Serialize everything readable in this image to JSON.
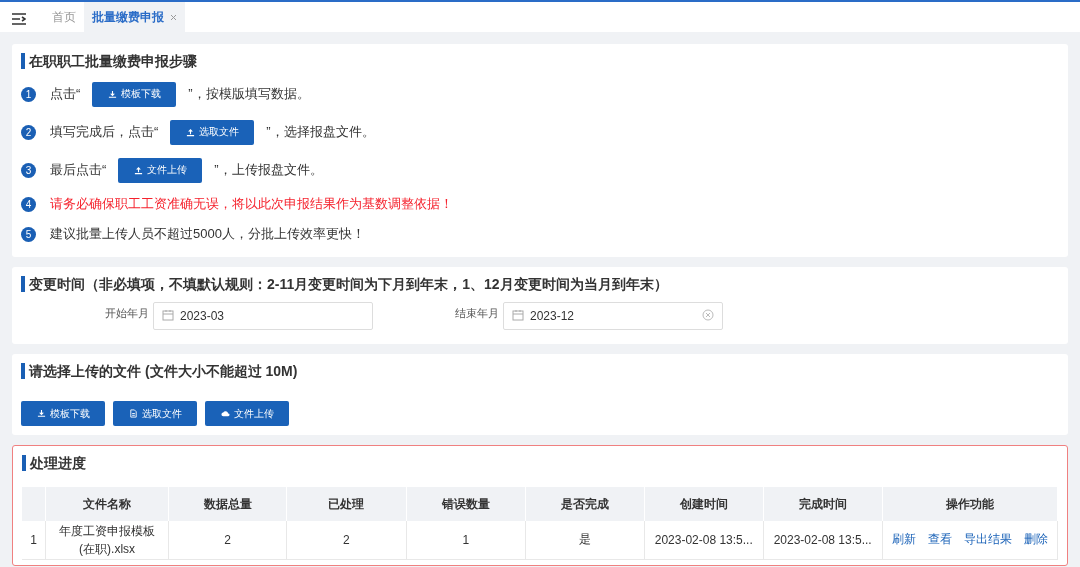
{
  "tabs": [
    {
      "label": "首页",
      "selected": false,
      "closable": false
    },
    {
      "label": "批量缴费申报",
      "selected": true,
      "closable": true
    }
  ],
  "steps_section": {
    "title": "在职职工批量缴费申报步骤",
    "steps": [
      {
        "number": "1",
        "kind": "button",
        "before": "点击“",
        "button": {
          "label": "模板下载"
        },
        "after": "”，按模版填写数据。"
      },
      {
        "number": "2",
        "kind": "button",
        "before": "填写完成后，点击“",
        "button": {
          "label": "选取文件"
        },
        "after": "”，选择报盘文件。"
      },
      {
        "number": "3",
        "kind": "button",
        "before": "最后点击“",
        "button": {
          "label": "文件上传"
        },
        "after": "”，上传报盘文件。"
      },
      {
        "number": "4",
        "kind": "warning",
        "text": "请务必确保职工工资准确无误，将以此次申报结果作为基数调整依据！"
      },
      {
        "number": "5",
        "kind": "text",
        "text": "建议批量上传人员不超过5000人，分批上传效率更快！"
      }
    ]
  },
  "change_time": {
    "title": "变更时间（非必填项，不填默认规则：2-11月变更时间为下月到年末，1、12月变更时间为当月到年末）",
    "fields": [
      {
        "label": "开始年月",
        "value": "2023-03",
        "clearable": false
      },
      {
        "label": "结束年月",
        "value": "2023-12",
        "clearable": true
      }
    ]
  },
  "upload": {
    "title": "请选择上传的文件 (文件大小不能超过 10M)",
    "buttons": [
      {
        "label": "模板下载"
      },
      {
        "label": "选取文件"
      },
      {
        "label": "文件上传"
      }
    ]
  },
  "progress": {
    "title": "处理进度",
    "table": {
      "columns": [
        "文件名称",
        "数据总量",
        "已处理",
        "错误数量",
        "是否完成",
        "创建时间",
        "完成时间",
        "操作功能"
      ],
      "rows": [
        {
          "index": "1",
          "cells": [
            "年度工资申报模板(在职).xlsx",
            "2",
            "2",
            "1",
            "是",
            "2023-02-08 13:5...",
            "2023-02-08 13:5..."
          ],
          "actions": [
            "刷新",
            "查看",
            "导出结果",
            "删除"
          ]
        }
      ]
    }
  }
}
